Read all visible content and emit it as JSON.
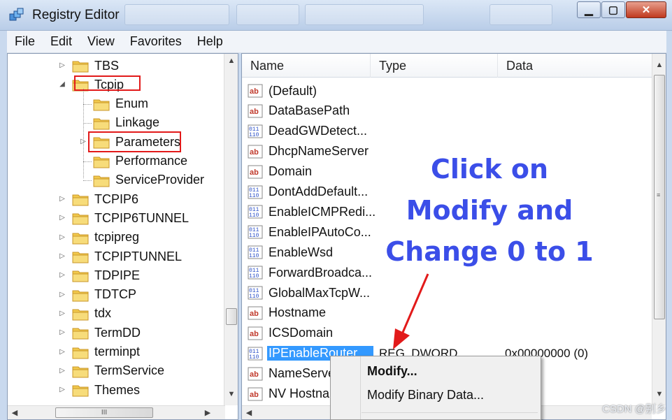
{
  "window": {
    "title": "Registry Editor",
    "background_tabs": [
      "",
      "",
      "",
      ""
    ]
  },
  "menubar": [
    "File",
    "Edit",
    "View",
    "Favorites",
    "Help"
  ],
  "tree": {
    "items": [
      {
        "label": "TBS",
        "level": 0,
        "expander": "collapsed"
      },
      {
        "label": "Tcpip",
        "level": 0,
        "expander": "expanded"
      },
      {
        "label": "Enum",
        "level": 1,
        "expander": "none"
      },
      {
        "label": "Linkage",
        "level": 1,
        "expander": "none"
      },
      {
        "label": "Parameters",
        "level": 1,
        "expander": "collapsed"
      },
      {
        "label": "Performance",
        "level": 1,
        "expander": "none"
      },
      {
        "label": "ServiceProvider",
        "level": 1,
        "expander": "none"
      },
      {
        "label": "TCPIP6",
        "level": 0,
        "expander": "collapsed"
      },
      {
        "label": "TCPIP6TUNNEL",
        "level": 0,
        "expander": "collapsed"
      },
      {
        "label": "tcpipreg",
        "level": 0,
        "expander": "collapsed"
      },
      {
        "label": "TCPIPTUNNEL",
        "level": 0,
        "expander": "collapsed"
      },
      {
        "label": "TDPIPE",
        "level": 0,
        "expander": "collapsed"
      },
      {
        "label": "TDTCP",
        "level": 0,
        "expander": "collapsed"
      },
      {
        "label": "tdx",
        "level": 0,
        "expander": "collapsed"
      },
      {
        "label": "TermDD",
        "level": 0,
        "expander": "collapsed"
      },
      {
        "label": "terminpt",
        "level": 0,
        "expander": "collapsed"
      },
      {
        "label": "TermService",
        "level": 0,
        "expander": "collapsed"
      },
      {
        "label": "Themes",
        "level": 0,
        "expander": "collapsed"
      }
    ],
    "hscroll_grip": "III"
  },
  "list": {
    "columns": [
      "Name",
      "Type",
      "Data"
    ],
    "rows": [
      {
        "name": "(Default)",
        "icon": "string-icon",
        "type": "",
        "data": ""
      },
      {
        "name": "DataBasePath",
        "icon": "string-icon",
        "type": "",
        "data": ""
      },
      {
        "name": "DeadGWDetect...",
        "icon": "dword-icon",
        "type": "",
        "data": ""
      },
      {
        "name": "DhcpNameServer",
        "icon": "string-icon",
        "type": "",
        "data": ""
      },
      {
        "name": "Domain",
        "icon": "string-icon",
        "type": "",
        "data": ""
      },
      {
        "name": "DontAddDefault...",
        "icon": "dword-icon",
        "type": "",
        "data": ""
      },
      {
        "name": "EnableICMPRedi...",
        "icon": "dword-icon",
        "type": "",
        "data": ""
      },
      {
        "name": "EnableIPAutoCo...",
        "icon": "dword-icon",
        "type": "",
        "data": ""
      },
      {
        "name": "EnableWsd",
        "icon": "dword-icon",
        "type": "",
        "data": ""
      },
      {
        "name": "ForwardBroadca...",
        "icon": "dword-icon",
        "type": "",
        "data": ""
      },
      {
        "name": "GlobalMaxTcpW...",
        "icon": "dword-icon",
        "type": "",
        "data": ""
      },
      {
        "name": "Hostname",
        "icon": "string-icon",
        "type": "",
        "data": ""
      },
      {
        "name": "ICSDomain",
        "icon": "string-icon",
        "type": "",
        "data": ""
      },
      {
        "name": "IPEnableRouter",
        "icon": "dword-icon",
        "type": "REG_DWORD",
        "data": "0x00000000 (0)"
      },
      {
        "name": "NameServer",
        "icon": "string-icon",
        "type": "",
        "data": ""
      },
      {
        "name": "NV Hostname",
        "icon": "string-icon",
        "type": "",
        "data": ""
      }
    ]
  },
  "annotation": {
    "lines": [
      "Click on",
      "Modify and",
      "Change 0 to 1"
    ],
    "color": "#3b4ee8",
    "arrow_color": "#e21a1a"
  },
  "context_menu": {
    "items": [
      "Modify...",
      "Modify Binary Data..."
    ]
  },
  "watermark": "CSDN @别乡"
}
